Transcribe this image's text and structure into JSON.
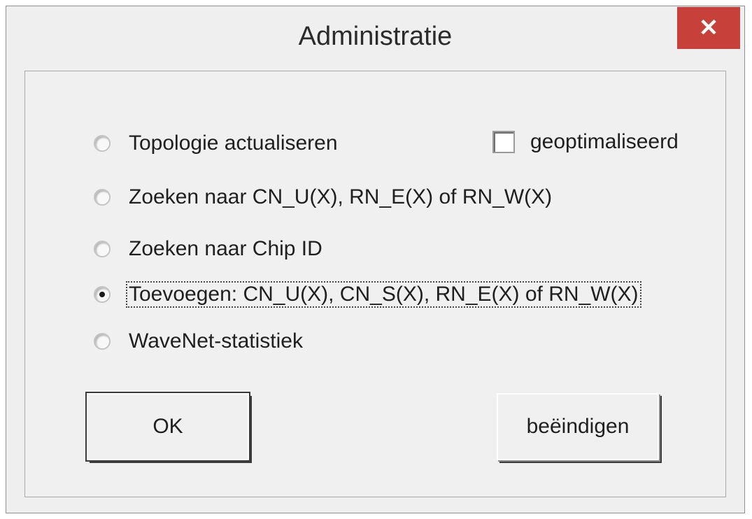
{
  "window": {
    "title": "Administratie",
    "close_label": "✕"
  },
  "options": [
    {
      "label": "Topologie actualiseren",
      "checked": false
    },
    {
      "label": "Zoeken naar CN_U(X), RN_E(X) of RN_W(X)",
      "checked": false
    },
    {
      "label": "Zoeken naar Chip ID",
      "checked": false
    },
    {
      "label": "Toevoegen: CN_U(X), CN_S(X), RN_E(X) of RN_W(X)",
      "checked": true
    },
    {
      "label": "WaveNet-statistiek",
      "checked": false
    }
  ],
  "optimized_checkbox": {
    "label": "geoptimaliseerd",
    "checked": false
  },
  "buttons": {
    "ok_label": "OK",
    "end_label": "beëindigen"
  }
}
